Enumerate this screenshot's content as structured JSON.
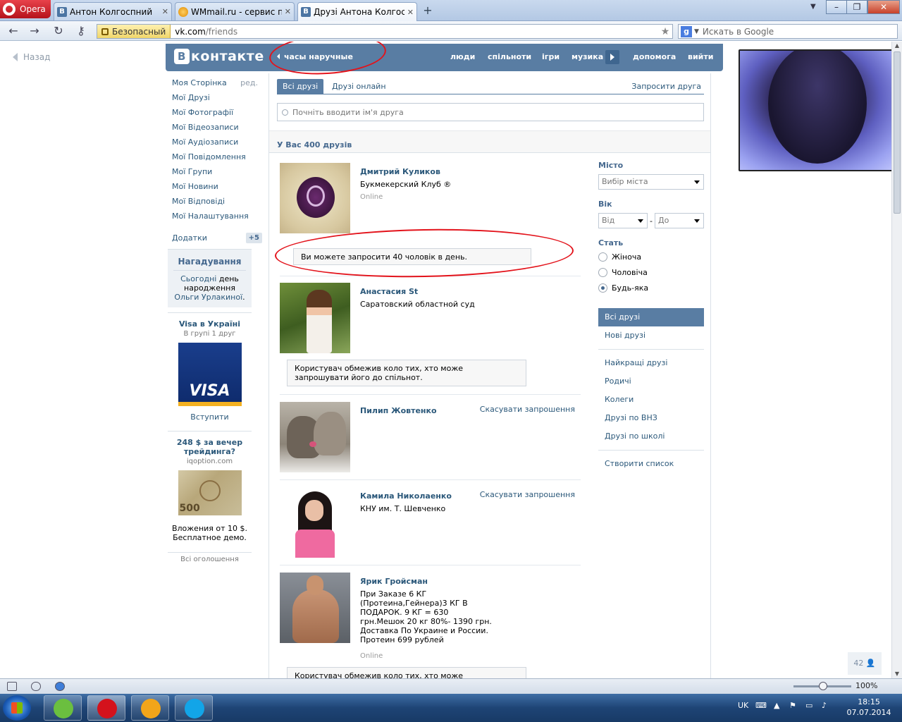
{
  "browser": {
    "menu_label": "Opera",
    "tabs": [
      {
        "title": "Антон Колгоспний"
      },
      {
        "title": "WMmail.ru - сервис п..."
      },
      {
        "title": "Друзі Антона Колгосп..."
      }
    ],
    "secure_label": "Безопасный",
    "url_host": "vk.com",
    "url_path": "/friends",
    "search_placeholder": "Искать в Google"
  },
  "back_label": "Назад",
  "header": {
    "logo_text": "контакте",
    "status": "часы наручные",
    "nav": [
      "люди",
      "спільноти",
      "ігри",
      "музика",
      "допомога",
      "вийти"
    ]
  },
  "sidebar": {
    "items": [
      {
        "label": "Моя Сторінка"
      },
      {
        "label": "Мої Друзі"
      },
      {
        "label": "Мої Фотографії"
      },
      {
        "label": "Мої Відеозаписи"
      },
      {
        "label": "Мої Аудіозаписи"
      },
      {
        "label": "Мої Повідомлення"
      },
      {
        "label": "Мої Групи"
      },
      {
        "label": "Мої Новини"
      },
      {
        "label": "Мої Відповіді"
      },
      {
        "label": "Мої Налаштування"
      }
    ],
    "edit_label": "ред.",
    "apps_label": "Додатки",
    "apps_badge": "+5"
  },
  "reminder": {
    "title": "Нагадування",
    "today": "Сьогодні",
    "text_mid": " день народження ",
    "name": "Ольги Урлакиної",
    "dot": "."
  },
  "ads": [
    {
      "title": "Visa в Україні",
      "sub": "В групі 1 друг",
      "brand": "VISA",
      "action": "Вступити"
    },
    {
      "title": "248 $ за вечер трейдинга?",
      "sub": "iqoption.com",
      "note": "500",
      "text": "Вложения от 10 $. Бесплатное демо."
    }
  ],
  "all_ads_label": "Всі оголошення",
  "main": {
    "tab_all": "Всі друзі",
    "tab_online": "Друзі онлайн",
    "invite_label": "Запросити друга",
    "search_placeholder": "Почніть вводити ім'я друга",
    "count_label": "У Вас 400 друзів"
  },
  "friends": [
    {
      "name": "Дмитрий Куликов",
      "desc": "Букмекерский Клуб ®",
      "online": "Online",
      "action": ""
    },
    {
      "name": "Анастасия St",
      "desc": "Саратовский областной суд",
      "online": "",
      "action": ""
    },
    {
      "name": "Пилип Жовтенко",
      "desc": "",
      "online": "",
      "action": "Скасувати запрошення"
    },
    {
      "name": "Камила Николаенко",
      "desc": "КНУ им. Т. Шевченко",
      "online": "",
      "action": "Скасувати запрошення"
    },
    {
      "name": "Ярик Гройсман",
      "desc": "При Заказе 6 КГ (Протеина,Гейнера)3 КГ В ПОДАРОК. 9 КГ = 630 грн.Мешок 20 кг 80%- 1390 грн. Доставка По Украине и России. Протеин 699 рублей",
      "online": "Online",
      "action": ""
    }
  ],
  "notices": {
    "limit": "Ви можете запросити 40 чоловік в день.",
    "restricted": "Користувач обмежив коло тих, хто може запрошувати його до спільнот."
  },
  "filters": {
    "city_label": "Місто",
    "city_value": "Вибір міста",
    "age_label": "Вік",
    "age_from": "Від",
    "age_dash": "-",
    "age_to": "До",
    "sex_label": "Стать",
    "sex_options": [
      "Жіноча",
      "Чоловіча",
      "Будь-яка"
    ],
    "sex_selected": 2,
    "nav": [
      "Всі друзі",
      "Нові друзі",
      "Найкращі друзі",
      "Родичі",
      "Колеги",
      "Друзі по ВНЗ",
      "Друзі по школі",
      "Створити список"
    ]
  },
  "counter": "42",
  "statusbar": {
    "zoom": "100%"
  },
  "taskbar": {
    "lang": "UK",
    "time": "18:15",
    "date": "07.07.2014"
  },
  "colors": {
    "vk_header": "#597da3",
    "vk_link": "#2b587a",
    "annotation_red": "#e3131b"
  }
}
